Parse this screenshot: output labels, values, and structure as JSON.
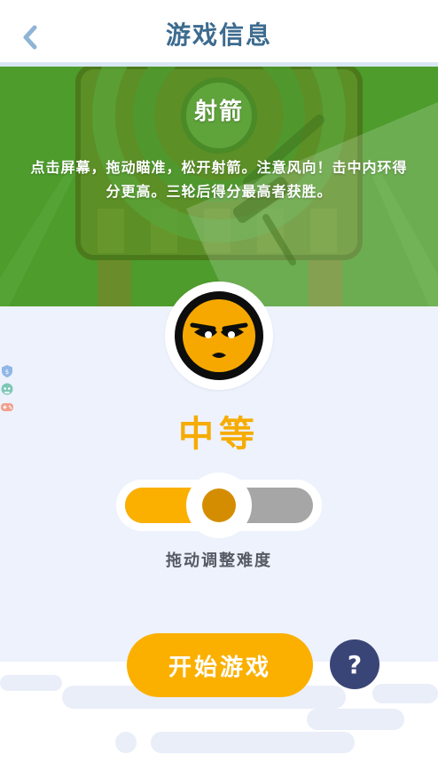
{
  "header": {
    "title": "游戏信息",
    "back_icon": "chevron-left-icon"
  },
  "banner": {
    "title": "射箭",
    "description_line1": "点击屏幕，拖动瞄准，松开射箭。注意风向！击中内环得",
    "description_line2": "分更高。三轮后得分最高者获胜。",
    "background_color": "#4a9a2a"
  },
  "difficulty": {
    "avatar_icon": "serious-face-icon",
    "label": "中等",
    "level_fraction": 0.5,
    "hint": "拖动调整难度",
    "colors": {
      "active": "#fbb000",
      "inactive": "#a6a6a6",
      "knob": "#d48d00"
    }
  },
  "actions": {
    "start_label": "开始游戏",
    "help_label": "?"
  },
  "side_icons": [
    "shield-icon",
    "robot-icon",
    "gamepad-icon"
  ],
  "colors": {
    "accent": "#fbb000",
    "title": "#3d6b8f",
    "help_bg": "#3a4577",
    "page_bg": "#edf2fd"
  }
}
